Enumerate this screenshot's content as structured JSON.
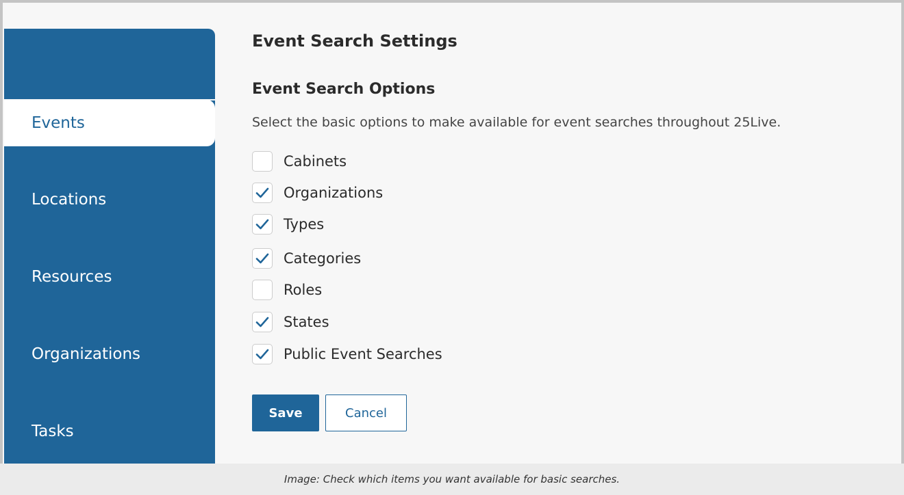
{
  "sidebar": {
    "items": [
      {
        "label": "Events",
        "active": true
      },
      {
        "label": "Locations",
        "active": false
      },
      {
        "label": "Resources",
        "active": false
      },
      {
        "label": "Organizations",
        "active": false
      },
      {
        "label": "Tasks",
        "active": false
      }
    ]
  },
  "main": {
    "title": "Event Search Settings",
    "section_title": "Event Search Options",
    "description": "Select the basic options to make available for event searches throughout 25Live.",
    "options": [
      {
        "label": "Cabinets",
        "checked": false
      },
      {
        "label": "Organizations",
        "checked": true
      },
      {
        "label": "Types",
        "checked": true
      },
      {
        "label": "Categories",
        "checked": true
      },
      {
        "label": "Roles",
        "checked": false
      },
      {
        "label": "States",
        "checked": true
      },
      {
        "label": "Public Event Searches",
        "checked": true
      }
    ],
    "save_label": "Save",
    "cancel_label": "Cancel"
  },
  "caption": "Image: Check which items you want available for basic searches.",
  "colors": {
    "accent": "#1f6599",
    "sidebar_bg": "#1f6599",
    "page_bg": "#f7f7f7",
    "caption_bg": "#ebebeb"
  },
  "icons": {
    "checkbox_checked": "checkmark-icon"
  }
}
